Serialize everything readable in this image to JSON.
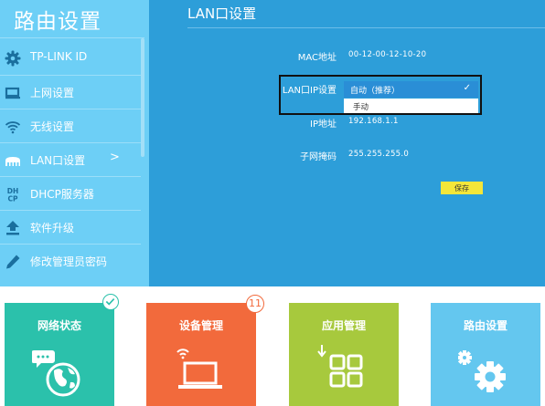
{
  "sidebar": {
    "title": "路由设置",
    "items": [
      {
        "label": "TP-LINK ID",
        "icon": "gear-icon"
      },
      {
        "label": "上网设置",
        "icon": "monitor-icon"
      },
      {
        "label": "无线设置",
        "icon": "wifi-icon"
      },
      {
        "label": "LAN口设置",
        "icon": "network-icon",
        "arrow": ">"
      },
      {
        "label": "DHCP服务器",
        "icon": "dhcp-icon"
      },
      {
        "label": "软件升级",
        "icon": "upload-icon"
      },
      {
        "label": "修改管理员密码",
        "icon": "pencil-icon"
      }
    ]
  },
  "main": {
    "heading": "LAN口设置",
    "mac": {
      "label": "MAC地址",
      "value": "00-12-00-12-10-20"
    },
    "ip_setting": {
      "label": "LAN口IP设置",
      "selected": "自动（推荐）",
      "options": [
        "手动"
      ]
    },
    "ip": {
      "label": "IP地址",
      "value": "192.168.1.1"
    },
    "mask": {
      "label": "子网掩码",
      "value": "255.255.255.0"
    },
    "save_label": "保存"
  },
  "tiles": [
    {
      "label": "网络状态",
      "icon": "globe-icon"
    },
    {
      "label": "设备管理",
      "icon": "laptop-icon",
      "badge": "11"
    },
    {
      "label": "应用管理",
      "icon": "apps-icon"
    },
    {
      "label": "路由设置",
      "icon": "settings-gear-icon"
    }
  ],
  "colors": {
    "sidebar_bg": "#6dcff6",
    "main_bg": "#2d9ed9",
    "tile_network": "#2bc1ab",
    "tile_devices": "#f26a3c",
    "tile_apps": "#a7c93d",
    "tile_router": "#64c7ef",
    "save_button": "#f4e63a"
  }
}
